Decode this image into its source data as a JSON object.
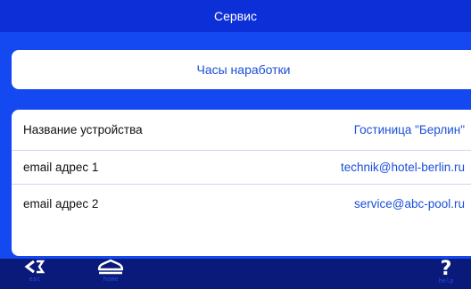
{
  "header": {
    "title": "Сервис"
  },
  "main": {
    "hours_button": "Часы наработки",
    "rows": [
      {
        "label": "Название устройства",
        "value": "Гостиница \"Берлин\""
      },
      {
        "label": "email адрес 1",
        "value": "technik@hotel-berlin.ru"
      },
      {
        "label": "email адрес 2",
        "value": "service@abc-pool.ru"
      }
    ]
  },
  "footer": {
    "esc": {
      "icon": "back-arrow-icon",
      "label": "esc"
    },
    "home": {
      "icon": "home-icon",
      "label": "home"
    },
    "help": {
      "icon": "help-icon",
      "label": "help"
    }
  },
  "colors": {
    "header_bg": "#0d2fd8",
    "content_bg": "#1449f2",
    "footer_bg": "#0a1a7a",
    "accent_text": "#1a4fd8"
  }
}
